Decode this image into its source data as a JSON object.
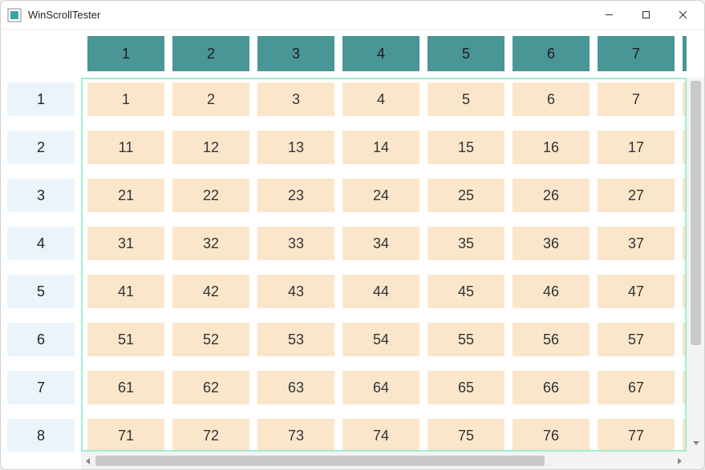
{
  "window": {
    "title": "WinScrollTester"
  },
  "colHeaders": [
    "1",
    "2",
    "3",
    "4",
    "5",
    "6",
    "7"
  ],
  "rowHeaders": [
    "1",
    "2",
    "3",
    "4",
    "5",
    "6",
    "7",
    "8"
  ],
  "cells": [
    [
      "1",
      "2",
      "3",
      "4",
      "5",
      "6",
      "7"
    ],
    [
      "11",
      "12",
      "13",
      "14",
      "15",
      "16",
      "17"
    ],
    [
      "21",
      "22",
      "23",
      "24",
      "25",
      "26",
      "27"
    ],
    [
      "31",
      "32",
      "33",
      "34",
      "35",
      "36",
      "37"
    ],
    [
      "41",
      "42",
      "43",
      "44",
      "45",
      "46",
      "47"
    ],
    [
      "51",
      "52",
      "53",
      "54",
      "55",
      "56",
      "57"
    ],
    [
      "61",
      "62",
      "63",
      "64",
      "65",
      "66",
      "67"
    ],
    [
      "71",
      "72",
      "73",
      "74",
      "75",
      "76",
      "77"
    ]
  ]
}
